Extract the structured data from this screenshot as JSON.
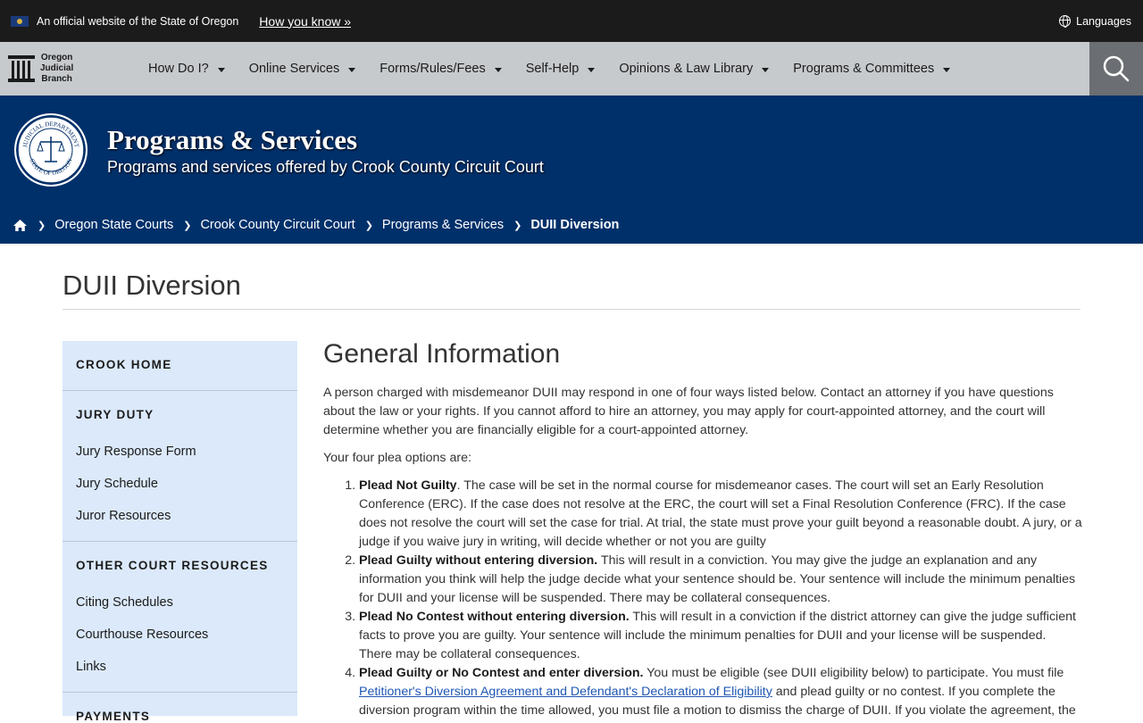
{
  "topbar": {
    "official_text": "An official website of the State of Oregon",
    "how_you_know": "How you know »",
    "languages": "Languages"
  },
  "logo": {
    "line1": "Oregon",
    "line2": "Judicial",
    "line3": "Branch"
  },
  "nav": {
    "items": [
      {
        "label": "How Do I?"
      },
      {
        "label": "Online Services"
      },
      {
        "label": "Forms/Rules/Fees"
      },
      {
        "label": "Self-Help"
      },
      {
        "label": "Opinions & Law Library"
      },
      {
        "label": "Programs & Committees"
      }
    ],
    "search_icon": "search-icon"
  },
  "banner": {
    "title": "Programs & Services",
    "subtitle": "Programs and services offered by Crook County Circuit Court",
    "seal_top": "JUDICIAL DEPARTMENT",
    "seal_bottom": "STATE OF OREGON",
    "bg_color": "#00306a"
  },
  "breadcrumb": {
    "home_icon": "home-icon",
    "items": [
      "Oregon State Courts",
      "Crook County Circuit Court",
      "Programs & Services"
    ],
    "current": "DUII Diversion"
  },
  "page": {
    "title": "DUII Diversion"
  },
  "sidebar": {
    "crook_home": "CROOK HOME",
    "jury_duty": "JURY DUTY",
    "jury_links": [
      "Jury Response Form",
      "Jury Schedule",
      "Juror Resources"
    ],
    "other_resources": "OTHER COURT RESOURCES",
    "other_links": [
      "Citing Schedules",
      "Courthouse Resources",
      "Links"
    ],
    "payments": "PAYMENTS"
  },
  "main": {
    "heading": "General Information",
    "intro": "A person charged with misdemeanor DUII may respond in one of four ways listed below. Contact an attorney if you have questions about the law or your rights. If you cannot afford to hire an attorney, you may apply for court-appointed attorney, and the court will determine whether you are financially eligible for a court-appointed attorney.",
    "options_label": "Your four plea options are:",
    "options": [
      {
        "title": "Plead Not Guilty",
        "text": ". The case will be set in the normal course for misdemeanor cases. The court will set an Early Resolution Conference (ERC). If the case does not resolve at the ERC, the court will set a Final Resolution Conference (FRC). If the case does not resolve the court will set the case for trial. At trial, the state must prove your guilt beyond a reasonable doubt. A jury, or a judge if you waive jury in writing, will decide whether or not you are guilty"
      },
      {
        "title": "Plead Guilty without entering diversion.",
        "text": " This will result in a conviction. You may give the judge an explanation and any information you think will help the judge decide what your sentence should be. Your sentence will include the minimum penalties for DUII and your license will be suspended. There may be collateral consequences."
      },
      {
        "title": "Plead No Contest without entering diversion.",
        "text": " This will result in a conviction if the district attorney can give the judge sufficient facts to prove you are guilty. Your sentence will include the minimum penalties for DUII and your license will be suspended. There may be collateral consequences."
      },
      {
        "title": "Plead Guilty or No Contest and enter diversion.",
        "text": " You must be eligible (see DUII eligibility below) to participate. You must file ",
        "link": "Petitioner's Diversion Agreement and Defendant's Declaration of Eligibility",
        "text2": " and plead guilty or no contest. If you complete the diversion program within the time allowed, you must file a motion to dismiss the charge of DUII. If you violate the agreement, the"
      }
    ]
  }
}
